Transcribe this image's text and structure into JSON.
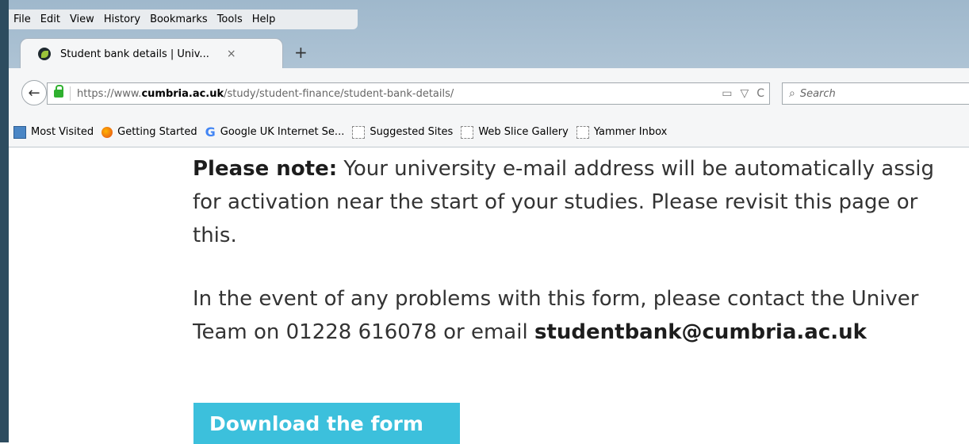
{
  "menu": [
    "File",
    "Edit",
    "View",
    "History",
    "Bookmarks",
    "Tools",
    "Help"
  ],
  "tab": {
    "title": "Student bank details | Univ...",
    "close": "×",
    "new": "+"
  },
  "navbar": {
    "back": "←",
    "url_prefix": "https://www.",
    "url_domain": "cumbria.ac.uk",
    "url_path": "/study/student-finance/student-bank-details/",
    "reload": "C",
    "search_placeholder": "Search"
  },
  "bookmarks": [
    "Most Visited",
    "Getting Started",
    "Google UK Internet Se...",
    "Suggested Sites",
    "Web Slice Gallery",
    "Yammer Inbox"
  ],
  "content": {
    "note_label": "Please note:",
    "note_line1": " Your university e-mail address will be automatically assig",
    "note_line2": "for activation near the start of your studies.  Please revisit this page or",
    "note_line3": "this.",
    "problem_line1": "In the event of any problems with this form, please contact the Univer",
    "problem_line2_text": "Team on 01228 616078 or email ",
    "problem_email": "studentbank@cumbria.ac.uk",
    "button_label": "Download the form"
  }
}
